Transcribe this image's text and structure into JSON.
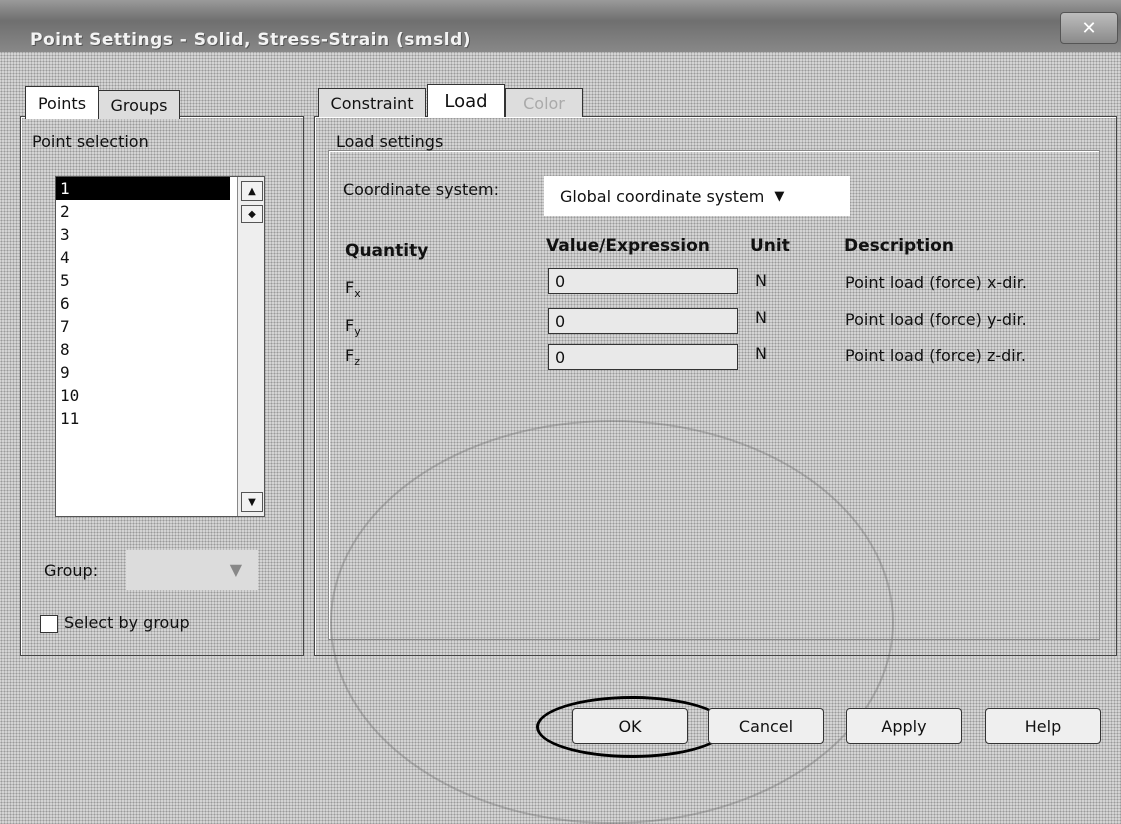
{
  "window": {
    "title": "Point Settings - Solid, Stress-Strain (smsld)",
    "close_label": "✕"
  },
  "left_tabs": [
    "Points",
    "Groups"
  ],
  "point_selection": {
    "header": "Point selection",
    "items": [
      "1",
      "2",
      "3",
      "4",
      "5",
      "6",
      "7",
      "8",
      "9",
      "10",
      "11"
    ],
    "selected": "1",
    "group_label": "Group:",
    "group_value": "",
    "select_by_group_label": "Select by group",
    "select_by_group_checked": false
  },
  "right_tabs": [
    "Constraint",
    "Load",
    "Color"
  ],
  "active_tab": "Load",
  "load": {
    "section_title": "Load settings",
    "coord_label": "Coordinate system:",
    "coord_value": "Global coordinate system",
    "columns": [
      "Quantity",
      "Value/Expression",
      "Unit",
      "Description"
    ],
    "rows": [
      {
        "quantity": "F",
        "sub": "x",
        "value": "0",
        "unit": "N",
        "description": "Point load (force) x-dir."
      },
      {
        "quantity": "F",
        "sub": "y",
        "value": "0",
        "unit": "N",
        "description": "Point load (force) y-dir."
      },
      {
        "quantity": "F",
        "sub": "z",
        "value": "0",
        "unit": "N",
        "description": "Point load (force) z-dir."
      }
    ]
  },
  "buttons": {
    "ok": "OK",
    "cancel": "Cancel",
    "apply": "Apply",
    "help": "Help"
  }
}
